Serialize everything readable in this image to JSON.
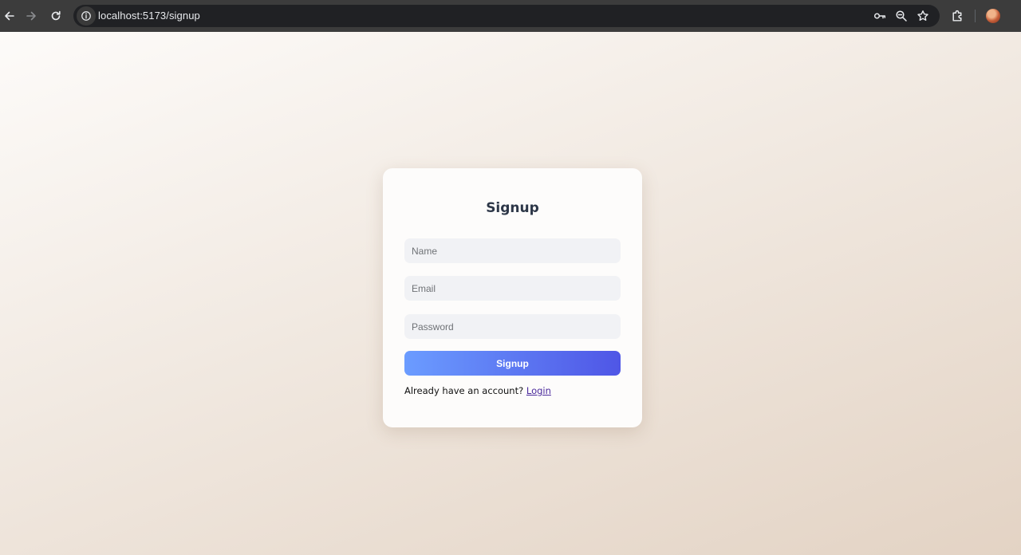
{
  "browser": {
    "url": "localhost:5173/signup"
  },
  "form": {
    "title": "Signup",
    "name_placeholder": "Name",
    "email_placeholder": "Email",
    "password_placeholder": "Password",
    "submit_label": "Signup",
    "footer_prompt": "Already have an account?",
    "login_link": "Login"
  },
  "colors": {
    "button_gradient_start": "#6b9cff",
    "button_gradient_end": "#4f56e6",
    "link": "#4b2a9c"
  }
}
